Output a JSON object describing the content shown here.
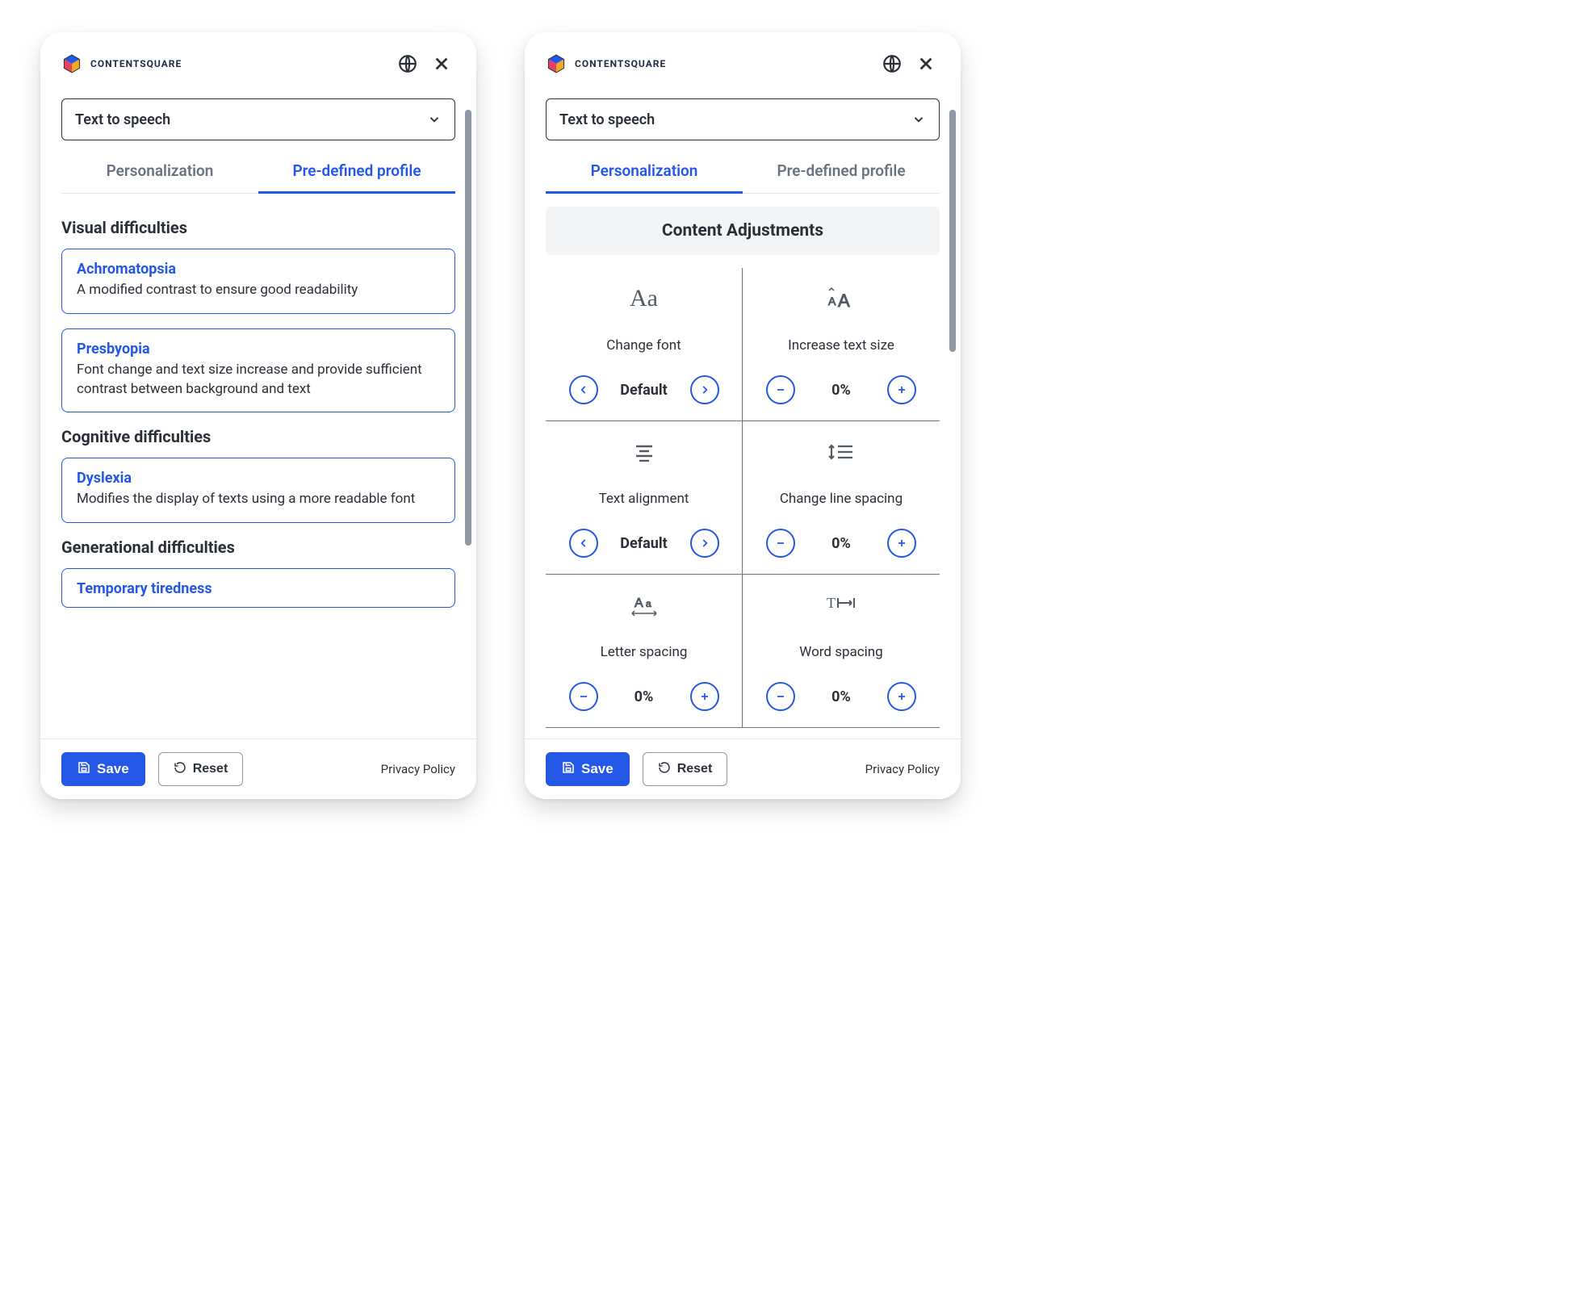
{
  "brand": "CONTENTSQUARE",
  "select": {
    "value": "Text to speech"
  },
  "tabs": {
    "personalization": "Personalization",
    "predefined": "Pre-defined profile"
  },
  "panelA": {
    "activeTab": "predefined",
    "sections": [
      {
        "heading": "Visual difficulties",
        "items": [
          {
            "title": "Achromatopsia",
            "desc": "A modified contrast to ensure good readability"
          },
          {
            "title": "Presbyopia",
            "desc": "Font change and text size increase and provide sufficient contrast between background and text"
          }
        ]
      },
      {
        "heading": "Cognitive difficulties",
        "items": [
          {
            "title": "Dyslexia",
            "desc": "Modifies the display of texts using a more readable font"
          }
        ]
      },
      {
        "heading": "Generational difficulties",
        "items": [
          {
            "title": "Temporary tiredness",
            "desc": ""
          }
        ]
      }
    ]
  },
  "panelB": {
    "activeTab": "personalization",
    "content_header": "Content Adjustments",
    "cells": [
      {
        "icon": "font-icon",
        "label": "Change font",
        "kind": "choice",
        "value": "Default"
      },
      {
        "icon": "text-size-icon",
        "label": "Increase text size",
        "kind": "pct",
        "value": "0%"
      },
      {
        "icon": "align-icon",
        "label": "Text alignment",
        "kind": "choice",
        "value": "Default"
      },
      {
        "icon": "line-spacing-icon",
        "label": "Change line spacing",
        "kind": "pct",
        "value": "0%"
      },
      {
        "icon": "letter-spacing-icon",
        "label": "Letter spacing",
        "kind": "pct",
        "value": "0%"
      },
      {
        "icon": "word-spacing-icon",
        "label": "Word spacing",
        "kind": "pct",
        "value": "0%"
      }
    ]
  },
  "footer": {
    "save": "Save",
    "reset": "Reset",
    "policy": "Privacy Policy"
  }
}
